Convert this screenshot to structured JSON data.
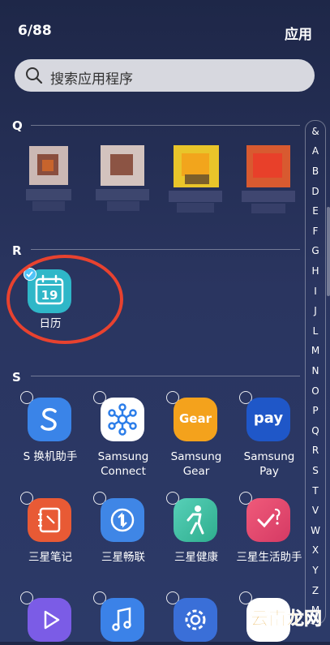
{
  "header": {
    "count": "6/88",
    "title": "应用"
  },
  "search": {
    "placeholder": "搜索应用程序"
  },
  "sections": [
    {
      "letter": "Q"
    },
    {
      "letter": "R"
    },
    {
      "letter": "S"
    }
  ],
  "r_apps": [
    {
      "label": "日历",
      "selected": true,
      "icon": "calendar-icon",
      "icon_number": "19"
    }
  ],
  "s_apps": [
    {
      "label": "S 换机助手",
      "icon": "smart-switch-icon",
      "color": "#3a84e8"
    },
    {
      "label": "Samsung Connect",
      "icon": "connect-icon",
      "color": "#ffffff"
    },
    {
      "label": "Samsung Gear",
      "icon": "gear-icon",
      "color": "#f4a21c",
      "icon_text": "Gear"
    },
    {
      "label": "Samsung Pay",
      "icon": "pay-icon",
      "color": "#1f57c8",
      "icon_text": "pay"
    },
    {
      "label": "三星笔记",
      "icon": "notes-icon",
      "color": "#e85a35"
    },
    {
      "label": "三星畅联",
      "icon": "sync-icon",
      "color": "#3f86e6"
    },
    {
      "label": "三星健康",
      "icon": "health-icon",
      "color": "#3cc1a0"
    },
    {
      "label": "三星生活助手",
      "icon": "life-assistant-icon",
      "color": "#e2426a"
    },
    {
      "label": "",
      "icon": "video-icon",
      "color": "#7b5ce6"
    },
    {
      "label": "",
      "icon": "music-icon",
      "color": "#3b82e8"
    },
    {
      "label": "",
      "icon": "settings-icon",
      "color": "#3a6fd8"
    },
    {
      "label": "",
      "icon": "app-icon",
      "color": "#ffffff"
    }
  ],
  "index_letters": [
    "&",
    "A",
    "B",
    "D",
    "E",
    "F",
    "G",
    "H",
    "I",
    "J",
    "L",
    "M",
    "N",
    "O",
    "P",
    "Q",
    "R",
    "S",
    "T",
    "V",
    "W",
    "X",
    "Y",
    "Z",
    "M"
  ],
  "watermark": "云南龙网",
  "colors": {
    "accent": "#4fc3f7",
    "highlight": "#e8422f"
  }
}
